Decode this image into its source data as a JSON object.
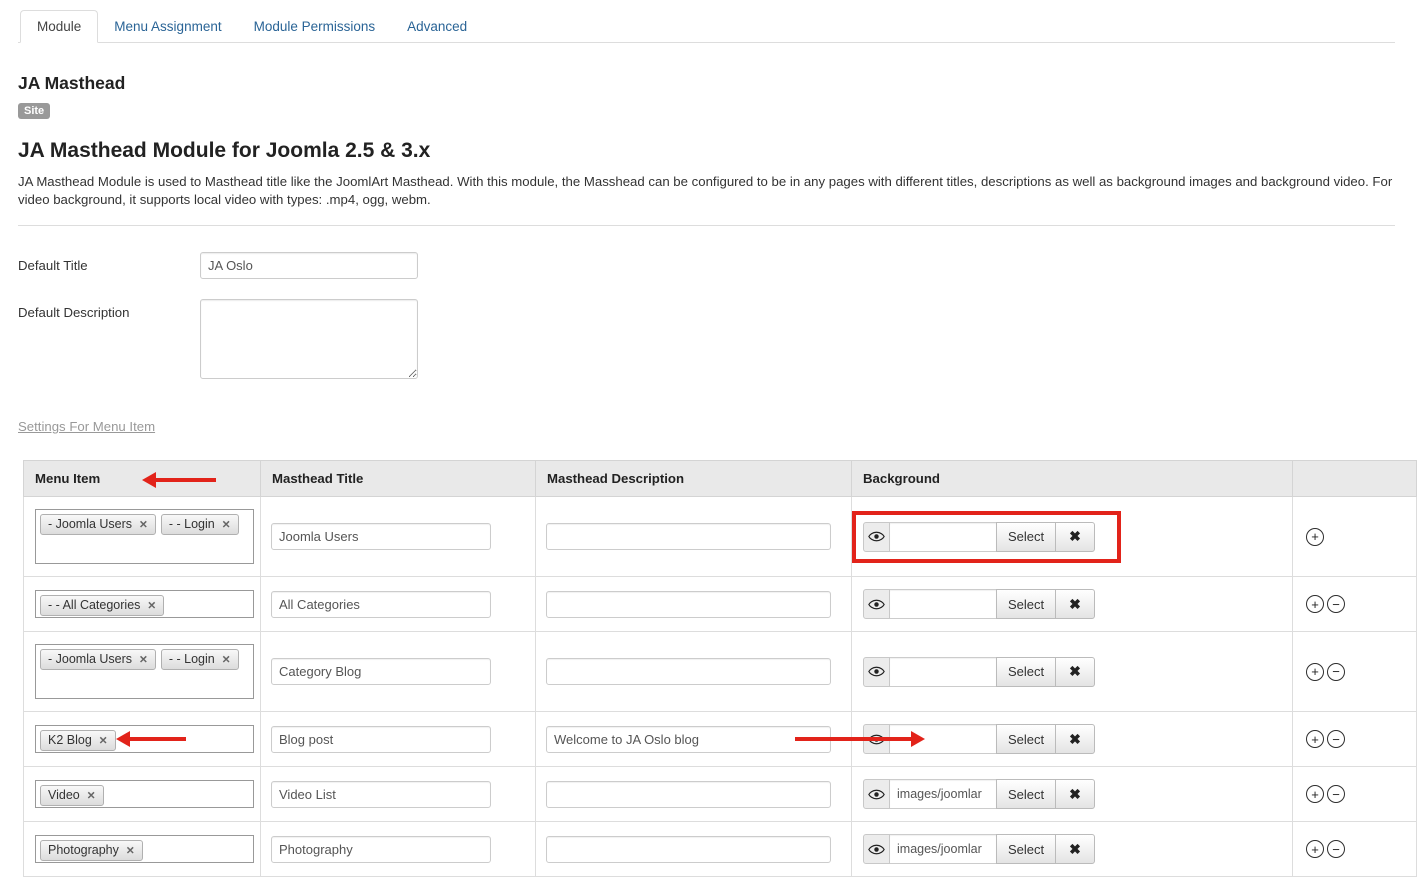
{
  "colors": {
    "accent_blue": "#2a6496",
    "annotation_red": "#e2231a",
    "table_header_bg": "#e9e9e9"
  },
  "icons": {
    "eye": "eye-icon",
    "clear": "✖",
    "tag_remove": "✕",
    "add": "+",
    "remove": "−"
  },
  "tabs": {
    "items": [
      {
        "label": "Module",
        "active": true
      },
      {
        "label": "Menu Assignment",
        "active": false
      },
      {
        "label": "Module Permissions",
        "active": false
      },
      {
        "label": "Advanced",
        "active": false
      }
    ]
  },
  "header": {
    "module_name": "JA Masthead",
    "badge": "Site",
    "title": "JA Masthead Module for Joomla 2.5 & 3.x",
    "description": "JA Masthead Module is used to Masthead title like the JoomlArt Masthead. With this module, the Masshead can be configured to be in any pages with different titles, descriptions as well as background images and background video. For video background, it supports local video with types: .mp4, ogg, webm."
  },
  "form": {
    "default_title_label": "Default Title",
    "default_title_value": "JA Oslo",
    "default_description_label": "Default Description",
    "default_description_value": ""
  },
  "settings_link_label": "Settings For Menu Item",
  "table": {
    "headers": [
      "Menu Item",
      "Masthead Title",
      "Masthead Description",
      "Background",
      ""
    ],
    "select_button_label": "Select",
    "rows": [
      {
        "menu_tags": [
          "- Joomla Users",
          "- - Login"
        ],
        "masthead_title": "Joomla Users",
        "masthead_description": "",
        "background": "",
        "tall": true,
        "actions": [
          "add"
        ],
        "annotations": [
          "box-around-background"
        ]
      },
      {
        "menu_tags": [
          "- - All Categories"
        ],
        "masthead_title": "All Categories",
        "masthead_description": "",
        "background": "",
        "tall": false,
        "actions": [
          "add",
          "remove"
        ],
        "annotations": []
      },
      {
        "menu_tags": [
          "- Joomla Users",
          "- - Login"
        ],
        "masthead_title": "Category Blog",
        "masthead_description": "",
        "background": "",
        "tall": true,
        "actions": [
          "add",
          "remove"
        ],
        "annotations": []
      },
      {
        "menu_tags": [
          "K2 Blog"
        ],
        "masthead_title": "Blog post",
        "masthead_description": "Welcome to JA Oslo blog",
        "background": "",
        "tall": false,
        "actions": [
          "add",
          "remove"
        ],
        "annotations": [
          "arrow-in-menu",
          "arrow-to-background"
        ]
      },
      {
        "menu_tags": [
          "Video"
        ],
        "masthead_title": "Video List",
        "masthead_description": "",
        "background": "images/joomlar",
        "tall": false,
        "actions": [
          "add",
          "remove"
        ],
        "annotations": []
      },
      {
        "menu_tags": [
          "Photography"
        ],
        "masthead_title": "Photography",
        "masthead_description": "",
        "background": "images/joomlar",
        "tall": false,
        "actions": [
          "add",
          "remove"
        ],
        "annotations": []
      }
    ]
  }
}
